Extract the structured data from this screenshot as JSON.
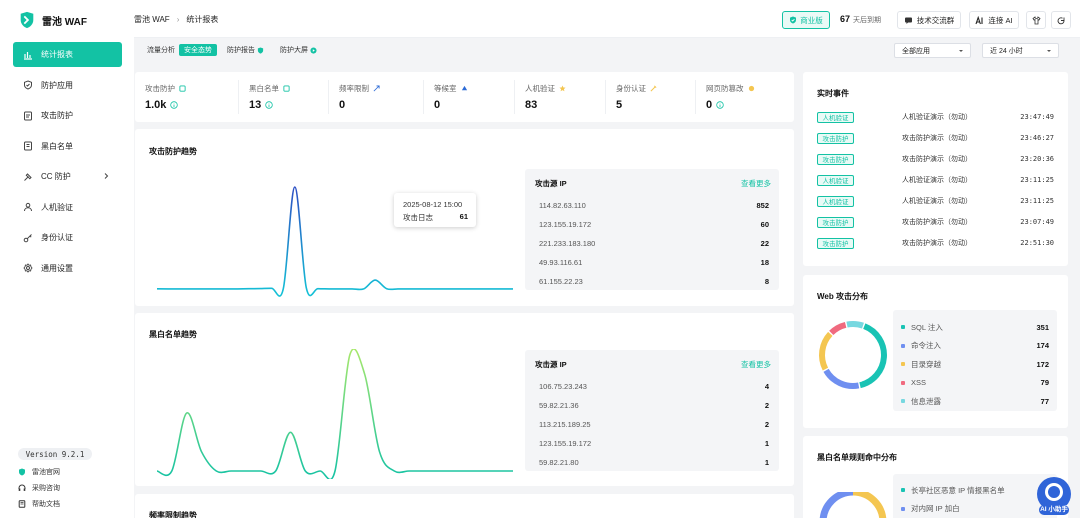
{
  "app": {
    "name": "雷池 WAF",
    "version": "Version 9.2.1"
  },
  "sidebar": {
    "items": [
      {
        "label": "统计报表",
        "icon": "chart-bar-icon",
        "active": true
      },
      {
        "label": "防护应用",
        "icon": "shield-icon"
      },
      {
        "label": "攻击防护",
        "icon": "document-shield-icon"
      },
      {
        "label": "黑白名单",
        "icon": "list-icon"
      },
      {
        "label": "CC 防护",
        "icon": "hammer-icon",
        "has_children": true
      },
      {
        "label": "人机验证",
        "icon": "user-check-icon"
      },
      {
        "label": "身份认证",
        "icon": "key-icon"
      },
      {
        "label": "通用设置",
        "icon": "gear-icon"
      }
    ],
    "footer_links": [
      {
        "label": "雷池官网",
        "icon": "shield-small-icon"
      },
      {
        "label": "采购咨询",
        "icon": "headset-icon"
      },
      {
        "label": "帮助文档",
        "icon": "book-icon"
      }
    ]
  },
  "header": {
    "breadcrumb": [
      "雷池 WAF",
      "统计报表"
    ],
    "edition": "商业版",
    "days_value": "67",
    "days_label": "天后到期",
    "buttons": {
      "community": "技术交流群",
      "ai": "连接 AI"
    }
  },
  "subnav": {
    "tabs": [
      "流量分析",
      "安全态势",
      "防护报告",
      "防护大屏"
    ],
    "active_tab": "安全态势",
    "app_select": "全部应用",
    "range_select": "近 24 小时"
  },
  "stats": [
    {
      "label": "攻击防护",
      "value": "1.0k",
      "info": true
    },
    {
      "label": "黑白名单",
      "value": "13",
      "info": true
    },
    {
      "label": "频率限制",
      "value": "0"
    },
    {
      "label": "等候室",
      "value": "0"
    },
    {
      "label": "人机验证",
      "value": "83"
    },
    {
      "label": "身份认证",
      "value": "5"
    },
    {
      "label": "网页防篡改",
      "value": "0",
      "info": true
    }
  ],
  "attack_trend": {
    "title": "攻击防护趋势",
    "tooltip": {
      "time": "2025-08-12 15:00",
      "label": "攻击日志",
      "value": "61"
    },
    "sources": {
      "header": "攻击源 IP",
      "more": "查看更多",
      "rows": [
        {
          "ip": "114.82.63.110",
          "count": "852"
        },
        {
          "ip": "123.155.19.172",
          "count": "60"
        },
        {
          "ip": "221.233.183.180",
          "count": "22"
        },
        {
          "ip": "49.93.116.61",
          "count": "18"
        },
        {
          "ip": "61.155.22.23",
          "count": "8"
        }
      ]
    }
  },
  "blacklist_trend": {
    "title": "黑白名单趋势",
    "sources": {
      "header": "攻击源 IP",
      "more": "查看更多",
      "rows": [
        {
          "ip": "106.75.23.243",
          "count": "4"
        },
        {
          "ip": "59.82.21.36",
          "count": "2"
        },
        {
          "ip": "113.215.189.25",
          "count": "2"
        },
        {
          "ip": "123.155.19.172",
          "count": "1"
        },
        {
          "ip": "59.82.21.80",
          "count": "1"
        }
      ]
    }
  },
  "rate_trend": {
    "title": "频率限制趋势"
  },
  "events": {
    "title": "实时事件",
    "rows": [
      {
        "tag": "人机验证",
        "desc": "人机验证演示（勿动）",
        "time": "23:47:49"
      },
      {
        "tag": "攻击防护",
        "desc": "攻击防护演示（勿动）",
        "time": "23:46:27"
      },
      {
        "tag": "攻击防护",
        "desc": "攻击防护演示（勿动）",
        "time": "23:20:36"
      },
      {
        "tag": "人机验证",
        "desc": "人机验证演示（勿动）",
        "time": "23:11:25"
      },
      {
        "tag": "人机验证",
        "desc": "人机验证演示（勿动）",
        "time": "23:11:25"
      },
      {
        "tag": "攻击防护",
        "desc": "攻击防护演示（勿动）",
        "time": "23:07:49"
      },
      {
        "tag": "攻击防护",
        "desc": "攻击防护演示（勿动）",
        "time": "22:51:30"
      }
    ]
  },
  "web_attack": {
    "title": "Web 攻击分布",
    "items": [
      {
        "label": "SQL 注入",
        "value": "351",
        "color": "#19c3b4"
      },
      {
        "label": "命令注入",
        "value": "174",
        "color": "#6f8ff0"
      },
      {
        "label": "目录穿越",
        "value": "172",
        "color": "#f4c651"
      },
      {
        "label": "XSS",
        "value": "79",
        "color": "#f06a7f"
      },
      {
        "label": "信息泄露",
        "value": "77",
        "color": "#77d8e0"
      }
    ]
  },
  "blacklist_rules": {
    "title": "黑白名单规则命中分布",
    "items": [
      {
        "label": "长亭社区恶意 IP 情报黑名单",
        "color": "#19c3b4"
      },
      {
        "label": "对内网 IP 加白",
        "color": "#6f8ff0"
      }
    ]
  },
  "ai_assistant": {
    "label": "AI 小助手"
  },
  "colors": {
    "accent": "#13c2a4",
    "primary_line": "#2d6bd6"
  },
  "chart_data": [
    {
      "type": "line",
      "title": "攻击防护趋势",
      "series": [
        {
          "values": [
            1,
            1,
            1,
            1,
            1,
            1,
            1,
            1,
            2,
            3,
            5,
            2,
            700,
            8,
            2,
            1,
            1,
            1,
            1,
            61,
            2,
            1,
            1,
            1,
            1,
            1,
            1,
            1,
            1,
            1,
            1,
            1
          ]
        }
      ],
      "ylim": [
        0,
        700
      ],
      "grid": false
    },
    {
      "type": "line",
      "title": "黑白名单趋势",
      "series": [
        {
          "values": [
            0,
            0,
            3,
            1,
            0,
            0,
            0,
            0,
            0,
            2,
            0,
            0,
            0,
            6,
            5,
            1,
            0,
            0,
            0,
            0,
            0,
            0,
            0,
            0,
            0
          ]
        }
      ],
      "ylim": [
        0,
        6
      ],
      "grid": false
    },
    {
      "type": "pie",
      "title": "Web 攻击分布",
      "categories": [
        "SQL 注入",
        "命令注入",
        "目录穿越",
        "XSS",
        "信息泄露"
      ],
      "values": [
        351,
        174,
        172,
        79,
        77
      ]
    }
  ]
}
